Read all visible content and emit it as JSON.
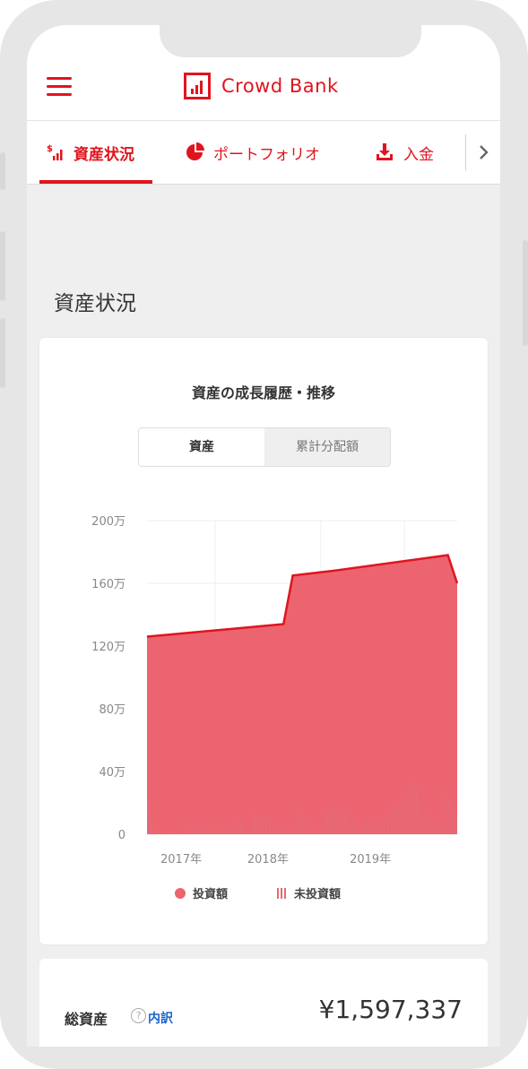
{
  "header": {
    "brand": "Crowd Bank"
  },
  "tabs": [
    {
      "label": "資産状況",
      "icon": "bar-chart-dollar-icon"
    },
    {
      "label": "ポートフォリオ",
      "icon": "pie-chart-icon"
    },
    {
      "label": "入金",
      "icon": "download-icon"
    }
  ],
  "page": {
    "title": "資産状況"
  },
  "card": {
    "title": "資産の成長履歴・推移",
    "toggle": [
      "資産",
      "累計分配額"
    ]
  },
  "chart_data": {
    "type": "area",
    "title": "資産の成長履歴・推移",
    "y_ticks": [
      "0",
      "40万",
      "80万",
      "120万",
      "160万",
      "200万"
    ],
    "x_ticks": [
      "2017年",
      "2018年",
      "2019年"
    ],
    "ylim": [
      0,
      2000000
    ],
    "legend": [
      "投資額",
      "未投資額"
    ],
    "legend_position": "bottom",
    "colors": {
      "invested": "#ec6470",
      "line": "#e0141e",
      "uninvested": "#e46a76"
    },
    "invested_series": [
      {
        "x": 0.0,
        "y": 1260000
      },
      {
        "x": 0.44,
        "y": 1340000
      },
      {
        "x": 0.47,
        "y": 1650000
      },
      {
        "x": 0.6,
        "y": 1680000
      },
      {
        "x": 0.97,
        "y": 1780000
      },
      {
        "x": 1.0,
        "y": 1600000
      }
    ],
    "uninvested_series": [
      {
        "x": 0.0,
        "y": 260000
      },
      {
        "x": 0.02,
        "y": 40000
      },
      {
        "x": 0.04,
        "y": 5000
      },
      {
        "x": 0.07,
        "y": 10000
      },
      {
        "x": 0.12,
        "y": 5000
      },
      {
        "x": 0.15,
        "y": 60000
      },
      {
        "x": 0.18,
        "y": 40000
      },
      {
        "x": 0.21,
        "y": 20000
      },
      {
        "x": 0.25,
        "y": 30000
      },
      {
        "x": 0.28,
        "y": 80000
      },
      {
        "x": 0.31,
        "y": 70000
      },
      {
        "x": 0.33,
        "y": 20000
      },
      {
        "x": 0.34,
        "y": 130000
      },
      {
        "x": 0.38,
        "y": 110000
      },
      {
        "x": 0.41,
        "y": 60000
      },
      {
        "x": 0.44,
        "y": 10000
      },
      {
        "x": 0.47,
        "y": 30000
      },
      {
        "x": 0.5,
        "y": 150000
      },
      {
        "x": 0.53,
        "y": 20000
      },
      {
        "x": 0.55,
        "y": 10000
      },
      {
        "x": 0.58,
        "y": 150000
      },
      {
        "x": 0.62,
        "y": 160000
      },
      {
        "x": 0.65,
        "y": 120000
      },
      {
        "x": 0.68,
        "y": 40000
      },
      {
        "x": 0.71,
        "y": 70000
      },
      {
        "x": 0.75,
        "y": 80000
      },
      {
        "x": 0.79,
        "y": 140000
      },
      {
        "x": 0.82,
        "y": 200000
      },
      {
        "x": 0.86,
        "y": 350000
      },
      {
        "x": 0.89,
        "y": 150000
      },
      {
        "x": 0.92,
        "y": 100000
      },
      {
        "x": 0.94,
        "y": 70000
      },
      {
        "x": 0.96,
        "y": 270000
      },
      {
        "x": 0.98,
        "y": 200000
      },
      {
        "x": 1.0,
        "y": 80000
      }
    ]
  },
  "summary": {
    "label": "総資産",
    "help": "?",
    "breakdown_link": "内訳",
    "value": "¥1,597,337"
  }
}
